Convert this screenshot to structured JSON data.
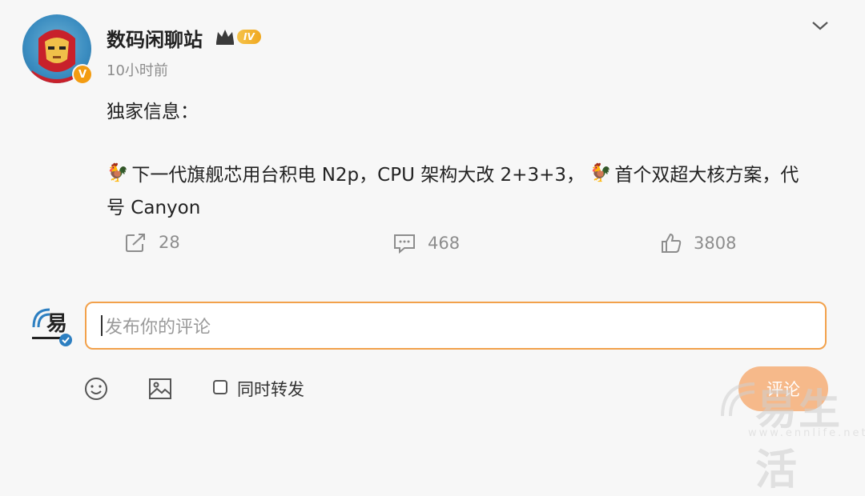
{
  "post": {
    "username": "数码闲聊站",
    "vip_level": "IV",
    "time": "10小时前",
    "heading": "独家信息：",
    "line1_a": "下一代旗舰芯用台积电 N2p，CPU 架构大改 2+3+3，",
    "line1_b": "首个双超大核方案，代",
    "line2": "号 Canyon",
    "verified_badge": "V"
  },
  "actions": {
    "repost_count": "28",
    "comment_count": "468",
    "like_count": "3808"
  },
  "comment_box": {
    "placeholder": "发布你的评论",
    "repost_label": "同时转发",
    "submit_label": "评论"
  },
  "watermark": {
    "text": "易生活",
    "url": "www.ennlife.net"
  },
  "icons": {
    "chevron": "chevron-down-icon",
    "rooster": "rooster-emoji-icon",
    "repost": "repost-icon",
    "comment": "comment-icon",
    "like": "like-icon",
    "emoji": "emoji-icon",
    "image": "image-icon"
  },
  "colors": {
    "accent": "#f2a14b",
    "submit": "#f6b98a",
    "vip_gold": "#f0a820",
    "secondary_text": "#8d8d8d"
  }
}
